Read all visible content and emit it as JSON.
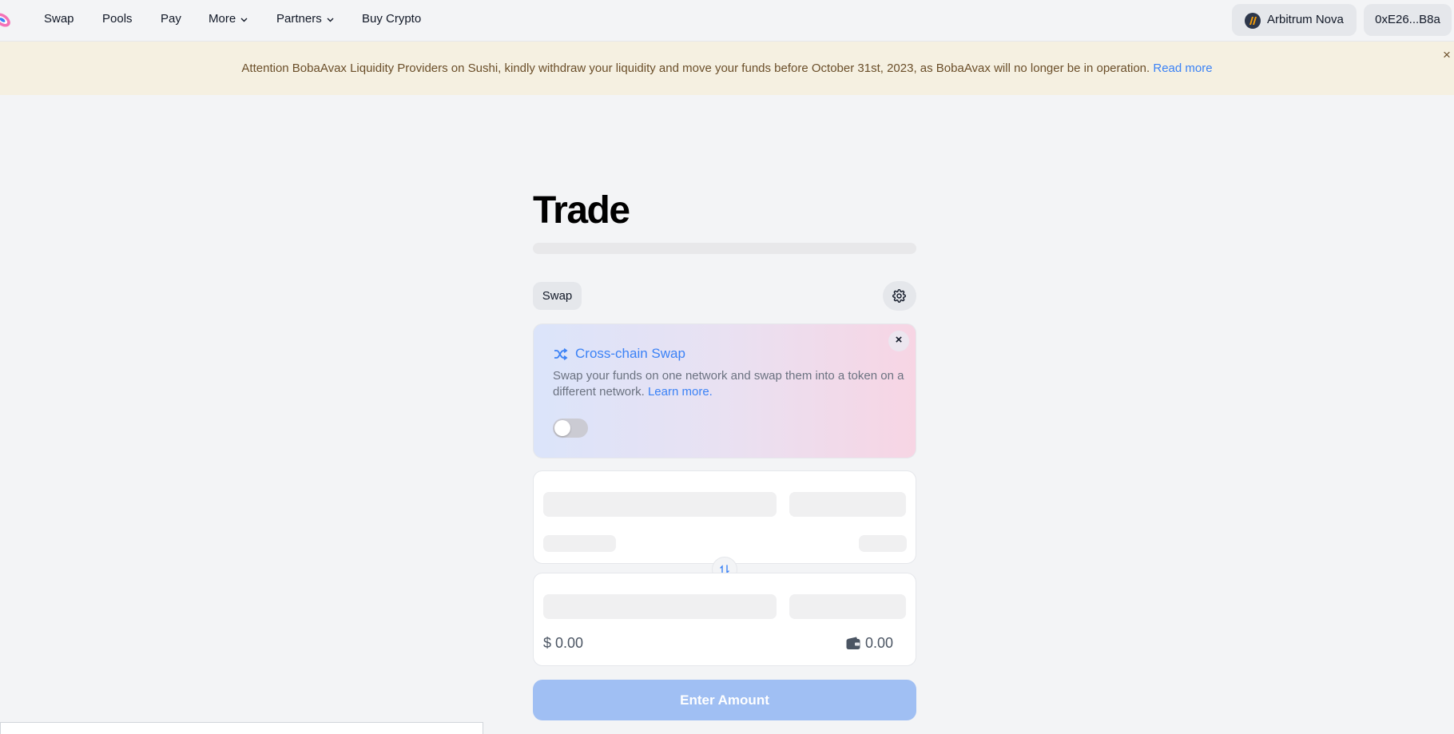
{
  "nav": {
    "items": [
      {
        "label": "Swap"
      },
      {
        "label": "Pools"
      },
      {
        "label": "Pay"
      },
      {
        "label": "More"
      },
      {
        "label": "Partners"
      },
      {
        "label": "Buy Crypto"
      }
    ],
    "network": "Arbitrum Nova",
    "account": "0xE26...B8a"
  },
  "banner": {
    "text": "Attention BobaAvax Liquidity Providers on Sushi, kindly withdraw your liquidity and move your funds before October 31st, 2023, as BobaAvax will no longer be in operation.",
    "link": "Read more",
    "close": "×"
  },
  "main": {
    "title": "Trade",
    "mode_chip": "Swap",
    "cross_chain": {
      "title": "Cross-chain Swap",
      "description": "Swap your funds on one network and swap them into a token on a different network.",
      "learn_more": "Learn more.",
      "close": "×",
      "enabled": false
    },
    "output": {
      "usd": "$ 0.00",
      "balance": "0.00"
    },
    "submit": "Enter Amount"
  },
  "colors": {
    "accent": "#3b82f6",
    "background": "#f3f4f6",
    "banner_bg": "#f5f0e1",
    "disabled_button": "#a0bff3"
  },
  "icons": [
    "sushi-logo-icon",
    "chevron-down-icon",
    "arbitrum-nova-icon",
    "gear-icon",
    "close-icon",
    "shuffle-icon",
    "swap-arrows-icon",
    "wallet-icon"
  ]
}
